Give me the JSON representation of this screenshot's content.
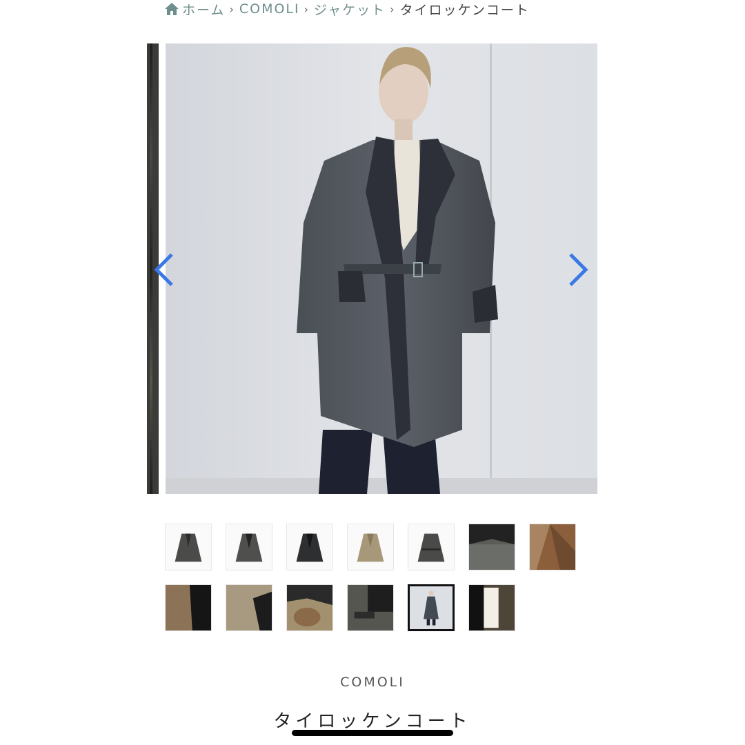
{
  "breadcrumb": {
    "home_label": "ホーム",
    "separator": "›",
    "brand_label": "COMOLI",
    "category_label": "ジャケット",
    "current_label": "タイロッケンコート"
  },
  "gallery": {
    "prev_icon": "chevron-left-icon",
    "next_icon": "chevron-right-icon",
    "arrow_color": "#3a78e6",
    "thumbnail_count": 13,
    "active_thumbnail": 11
  },
  "product": {
    "vendor": "COMOLI",
    "title": "タイロッケンコート"
  },
  "colors": {
    "link": "#6f8f8c",
    "text": "#333333"
  }
}
